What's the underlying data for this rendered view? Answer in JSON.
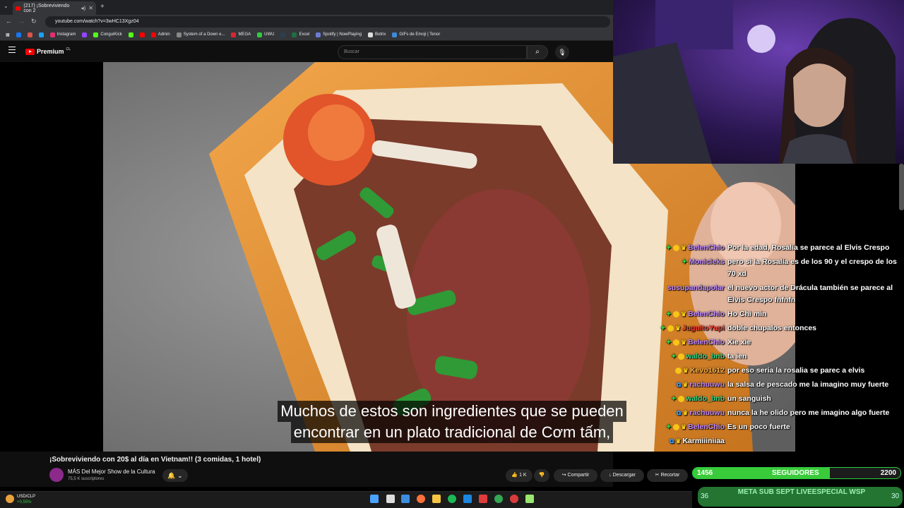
{
  "browser": {
    "tab_title": "(217) ¡Sobreviviendo con 2",
    "url": "youtube.com/watch?v=3wHC13Xgz04",
    "bookmarks": [
      "Instagram",
      "ConguiKick",
      "Admin",
      "System of a Down e...",
      "MEGA",
      "UWU",
      "Excel",
      "Spotify | NowPlaying",
      "Botrix",
      "GIFs de Emoji | Tenor"
    ]
  },
  "youtube": {
    "brand": "Premium",
    "region": "CL",
    "search_placeholder": "Buscar",
    "video_title": "¡Sobreviviendo con 20$ al día en Vietnam!! (3 comidas, 1 hotel)",
    "channel_name": "MÁS Del Mejor Show de la Cultura",
    "channel_subs": "75,5 K suscriptores",
    "likes": "1 K",
    "share": "Compartir",
    "download": "Descargar",
    "clip": "Recortar",
    "subtitle_line1": "Muchos de estos son ingredientes que se pueden",
    "subtitle_line2": "encontrar en un plato tradicional de Cơm tấm,"
  },
  "chat": [
    {
      "user": "BelenChio",
      "text": "Por la edad, Rosalía se parece al Elvis Crespo"
    },
    {
      "user": "Monicleks",
      "text": "pero si la Rosalía es de los 90 y el crespo de los 70 xd"
    },
    {
      "user": "susupandapolar",
      "text": "el nuevo actor de Drácula también se parece al Elvis Crespo fnfnfn"
    },
    {
      "user": "BelenChio",
      "text": "Ho Chi min"
    },
    {
      "user": "JuguitoYupi",
      "text": "doble chupalos entonces"
    },
    {
      "user": "BelenChio",
      "text": "Xie xie"
    },
    {
      "user": "waldo_bnb",
      "text": "ta ien"
    },
    {
      "user": "Kevo1612",
      "text": "por eso seria la rosalia se parec a elvis"
    },
    {
      "user": "rachuuwu",
      "text": "la salsa de pescado me la imagino muy fuerte"
    },
    {
      "user": "waldo_bnb",
      "text": "un sanguish"
    },
    {
      "user": "rachuuwu",
      "text": "nunca la he olido pero me imagino algo fuerte"
    },
    {
      "user": "BelenChio",
      "text": "Es un poco fuerte"
    },
    {
      "user": "Karmiiiniiaa",
      "text": ""
    }
  ],
  "overlay": {
    "followers_current": "1456",
    "followers_label": "SEGUIDORES",
    "followers_goal": "2200",
    "followers_progress": 0.66,
    "meta_text": "META SUB SEPT LIVEESPECIAL WSP",
    "meta_left": "36",
    "meta_right": "30"
  },
  "taskbar": {
    "stock_label": "USD/CLP",
    "stock_change": "+0,55%"
  },
  "colors": {
    "yt_red": "#ff0000",
    "chat_user": "#c48bff",
    "follower_green": "#3acb3a"
  }
}
